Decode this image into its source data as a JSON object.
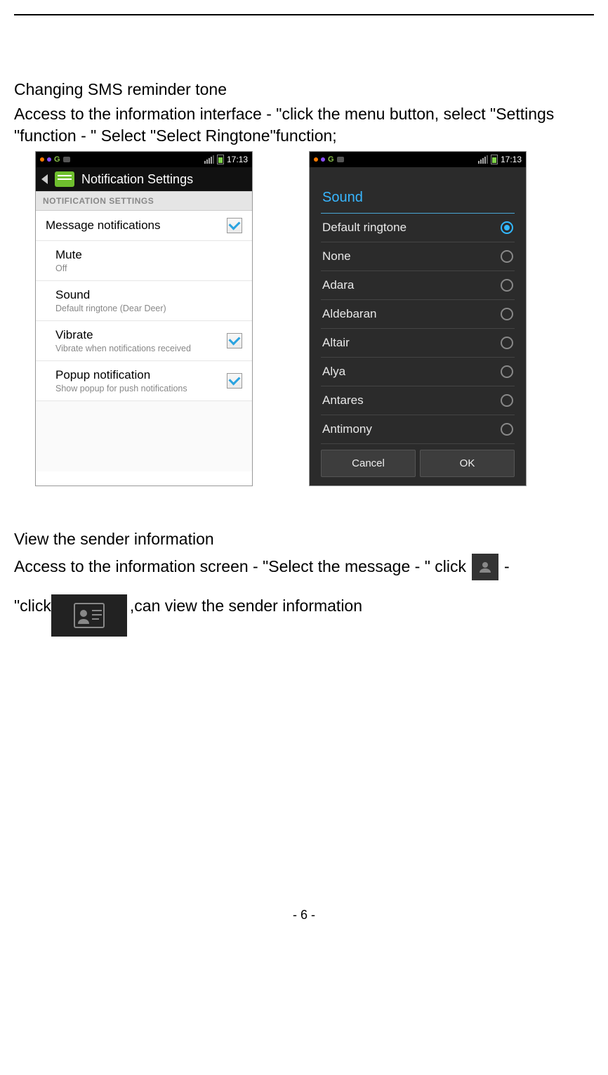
{
  "section1": {
    "heading": "Changing SMS reminder tone",
    "instruction": "Access to the information interface - \"click the menu button, select \"Settings \"function - \" Select \"Select Ringtone\"function;"
  },
  "statusbar": {
    "time": "17:13"
  },
  "screenshot1": {
    "title": "Notification Settings",
    "section_heading": "NOTIFICATION SETTINGS",
    "rows": {
      "message_notifications": {
        "title": "Message notifications",
        "checked": true
      },
      "mute": {
        "title": "Mute",
        "sub": "Off"
      },
      "sound": {
        "title": "Sound",
        "sub": "Default ringtone (Dear Deer)"
      },
      "vibrate": {
        "title": "Vibrate",
        "sub": "Vibrate when notifications received",
        "checked": true
      },
      "popup": {
        "title": "Popup notification",
        "sub": "Show popup for push notifications",
        "checked": true
      }
    }
  },
  "screenshot2": {
    "dialog_title": "Sound",
    "options": [
      {
        "label": "Default ringtone",
        "selected": true
      },
      {
        "label": "None",
        "selected": false
      },
      {
        "label": "Adara",
        "selected": false
      },
      {
        "label": "Aldebaran",
        "selected": false
      },
      {
        "label": "Altair",
        "selected": false
      },
      {
        "label": "Alya",
        "selected": false
      },
      {
        "label": "Antares",
        "selected": false
      },
      {
        "label": "Antimony",
        "selected": false
      }
    ],
    "cancel_label": "Cancel",
    "ok_label": "OK"
  },
  "section2": {
    "heading": "View the sender information",
    "part_a": "Access to the information screen - \"Select the message - \" click",
    "part_b_prefix": "\"click",
    "part_b_suffix": ",can view the sender information",
    "dash": "-"
  },
  "page_number": "- 6 -"
}
